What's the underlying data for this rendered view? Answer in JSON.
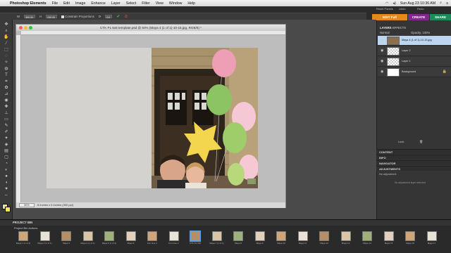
{
  "menubar": {
    "apple": "",
    "app": "Photoshop Elements",
    "items": [
      "File",
      "Edit",
      "Image",
      "Enhance",
      "Layer",
      "Select",
      "Filter",
      "View",
      "Window",
      "Help"
    ],
    "clock": "Sun Aug 23  10:36 AM"
  },
  "appbar": {
    "edit_full": "EDIT Full",
    "create": "CREATE",
    "share": "SHARE",
    "reset_panels": "Reset Panels",
    "undo": "Undo",
    "redo": "Redo"
  },
  "options": {
    "width_value": "300.00",
    "height_value": "230.00",
    "constrain_label": "Constrain Proportions",
    "rotate_value": "0.0"
  },
  "document": {
    "title": "CTK PL 5x6 template.psd @ 50% (Maya 4 (1 of 1)-10-15.jpg, RGB/8) *",
    "zoom": "50%",
    "size_status": "8 inches x 6 inches (300 ppi)"
  },
  "panel": {
    "tab_layers": "LAYERS",
    "tab_effects": "EFFECTS",
    "blend_mode": "Normal",
    "opacity_label": "Opacity: 100%",
    "layers": [
      {
        "name": "Maya 4 (1 of 1)-10-15.jpg",
        "selected": true
      },
      {
        "name": "Layer 2",
        "selected": false
      },
      {
        "name": "Layer 1",
        "selected": false
      },
      {
        "name": "Background",
        "selected": false
      }
    ],
    "lock_label": "Lock:",
    "sections": [
      "CONTENT",
      "INFO",
      "NAVIGATOR",
      "ADJUSTMENTS"
    ],
    "adjustments_text": "No adjustment",
    "adjustments_hint": "No adjustment layer selected"
  },
  "bin": {
    "title": "PROJECT BIN",
    "show_label": "Project Bin Actions",
    "items": [
      {
        "label": "Maya 1 (1 of 1)",
        "active": false
      },
      {
        "label": "Maya 2 (1 of 1)",
        "active": false
      },
      {
        "label": "Maya 3",
        "active": false
      },
      {
        "label": "Maya 4 (1 of 1)",
        "active": false
      },
      {
        "label": "Maya 5 (1 of 1)",
        "active": false
      },
      {
        "label": "Maya 6",
        "active": false
      },
      {
        "label": "Fun time 1",
        "active": false
      },
      {
        "label": "Fun time 2",
        "active": false
      },
      {
        "label": "CTK PL 5x6",
        "active": true
      },
      {
        "label": "Maya 7 (1 of 1)",
        "active": false
      },
      {
        "label": "Maya 8",
        "active": false
      },
      {
        "label": "Maya 9",
        "active": false
      },
      {
        "label": "Maya 10",
        "active": false
      },
      {
        "label": "Maya 11",
        "active": false
      },
      {
        "label": "Maya 12",
        "active": false
      },
      {
        "label": "Maya 13",
        "active": false
      },
      {
        "label": "Maya 14",
        "active": false
      },
      {
        "label": "Maya 15",
        "active": false
      },
      {
        "label": "Maya 16",
        "active": false
      },
      {
        "label": "Maya 17",
        "active": false
      }
    ]
  },
  "colors": {
    "edit_accent": "#e28a1b",
    "create_accent": "#7b2d84",
    "share_accent": "#1e8c5a",
    "selection": "#bcd6f2"
  }
}
